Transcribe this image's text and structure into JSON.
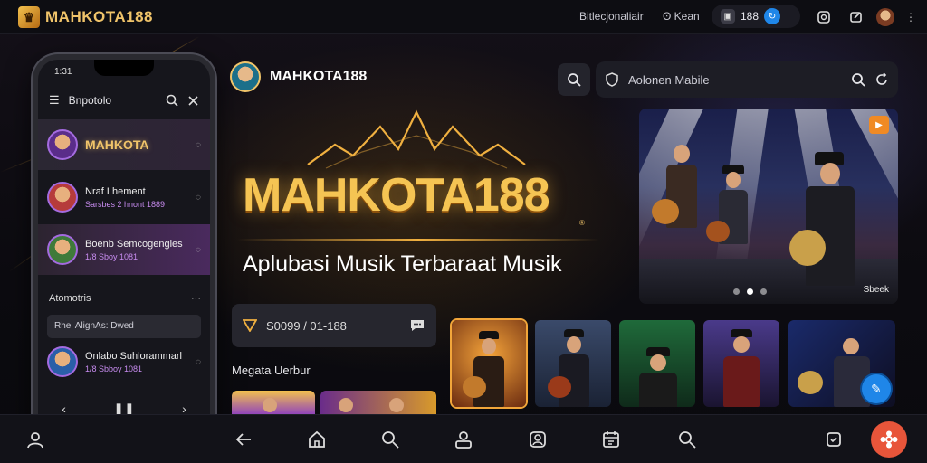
{
  "topbar": {
    "logo_text": "MAHKOTA188",
    "info_text": "Bitlecjonaliair",
    "info_sub": "ʘ Kean",
    "pill_value": "188"
  },
  "phone": {
    "status_time": "1:31",
    "header_title": "Bnpotolo",
    "items": [
      {
        "name": "MAHKOTA",
        "sub": ""
      },
      {
        "name": "Nraf Lhement",
        "sub": "Sarsbes 2 hnont 1889"
      },
      {
        "name": "Boenb Semcogengles",
        "sub": "1/8 Sboy 1081"
      }
    ],
    "section_title": "Atomotris",
    "section_more": "···",
    "input_text": "Rhel AlignAs: Dwed",
    "last_item": {
      "name": "Onlabo Suhlorammarl",
      "sub": "1/8 Sbboy 1081"
    }
  },
  "main": {
    "brand_name": "MAHKOTA188",
    "search_text": "Aolonen Mabile",
    "hero_title": "MAHKOTA188",
    "hero_reg": "®",
    "hero_subtitle": "Aplubasi Musik Terbaraat Musik",
    "promo_text": "S0099 / 01-188",
    "section_title": "Megata Uerbur",
    "concert_tag": "Sbeek"
  },
  "colors": {
    "gold": "#f5c453",
    "accent_orange": "#e8553a",
    "accent_blue": "#1f86e8",
    "purple": "#a46be0"
  },
  "icons": [
    "search-icon",
    "shield-icon",
    "refresh-icon",
    "close-icon",
    "menu-icon",
    "back-icon",
    "home-icon",
    "user-icon",
    "profile-icon",
    "calendar-icon",
    "chat-icon",
    "settings-icon"
  ]
}
